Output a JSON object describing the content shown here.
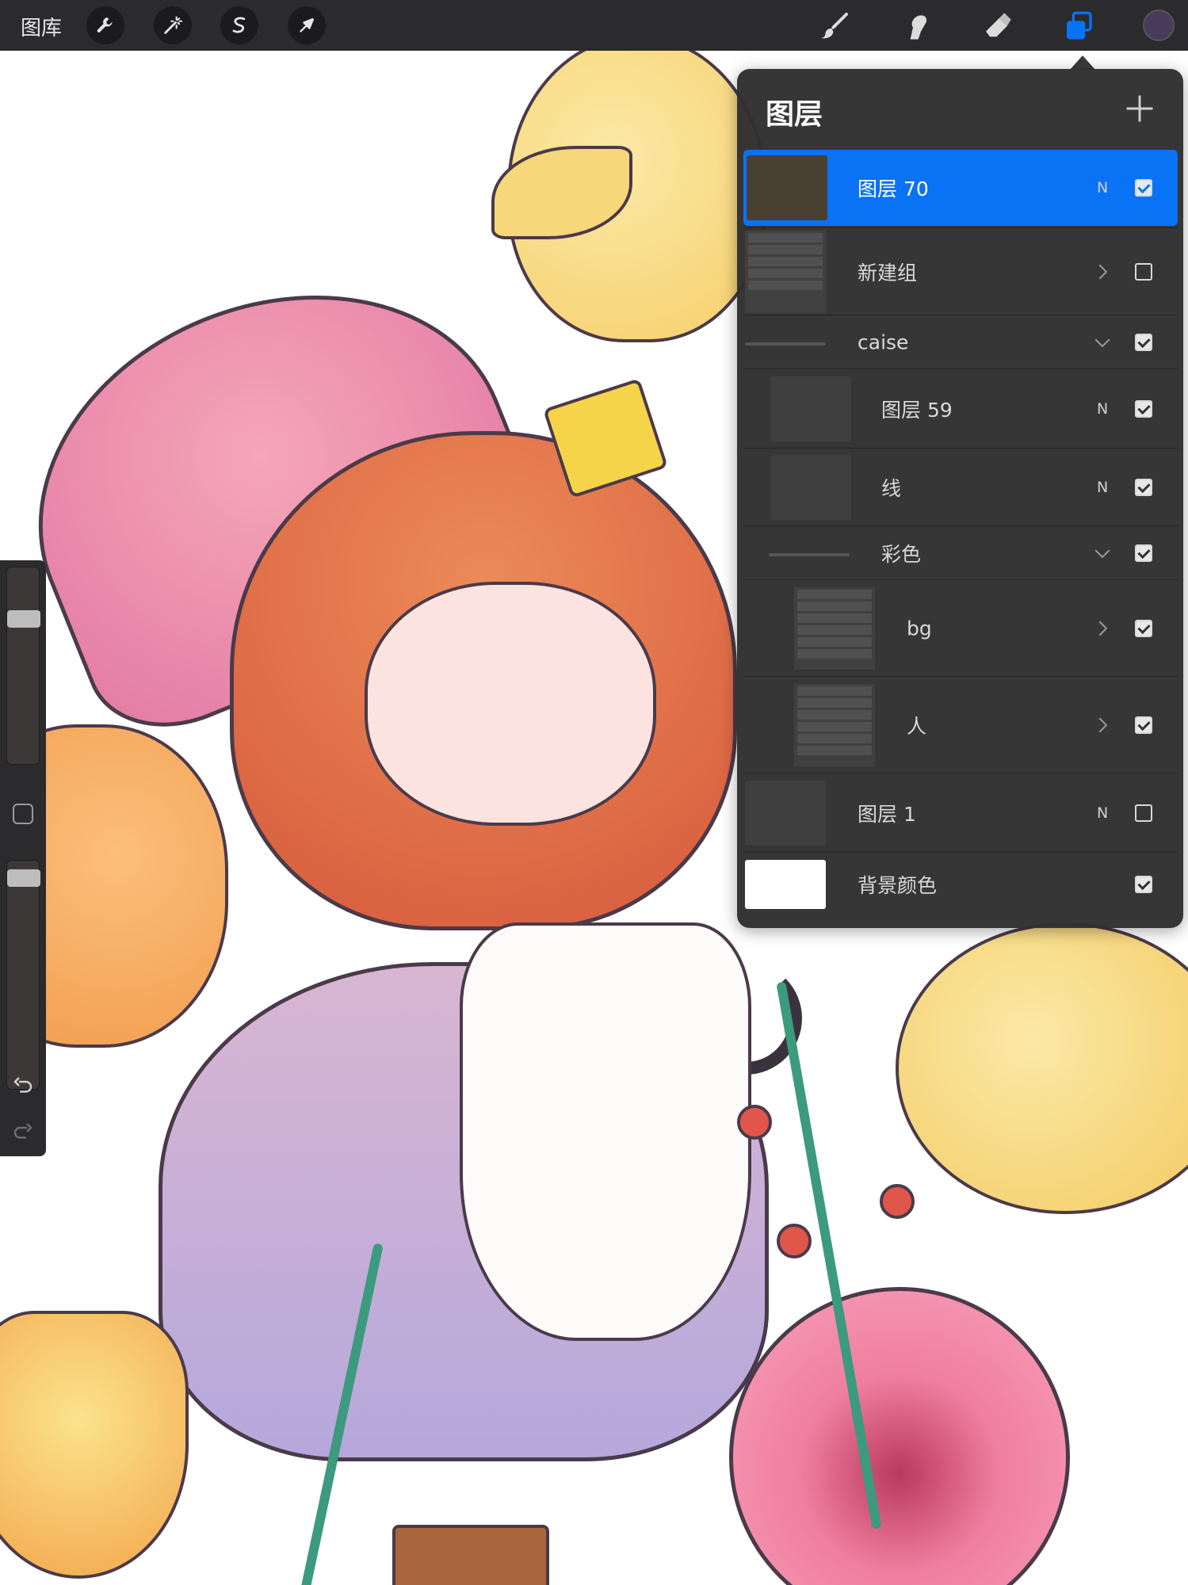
{
  "toolbar": {
    "gallery_label": "图库",
    "left_tools": [
      {
        "name": "actions",
        "icon": "wrench-icon"
      },
      {
        "name": "adjustments",
        "icon": "magic-wand-icon"
      },
      {
        "name": "selection",
        "icon": "selection-s-icon"
      },
      {
        "name": "transform",
        "icon": "arrow-cursor-icon"
      }
    ],
    "right_tools": [
      {
        "name": "paint",
        "icon": "brush-icon"
      },
      {
        "name": "smudge",
        "icon": "smudge-finger-icon"
      },
      {
        "name": "erase",
        "icon": "eraser-icon"
      },
      {
        "name": "layers",
        "icon": "layers-icon",
        "active": true
      }
    ],
    "current_color": "#4a3a5c",
    "accent_color": "#0a72f5"
  },
  "sidebar": {
    "brush_size_level": 0.76,
    "opacity_level": 0.96
  },
  "layers_panel": {
    "title": "图层",
    "add_icon": "plus-icon",
    "layers": [
      {
        "name": "图层 70",
        "blend": "N",
        "visible": true,
        "selected": true,
        "kind": "layer",
        "indent": 0
      },
      {
        "name": "新建组",
        "blend": "",
        "visible": false,
        "kind": "group-collapsed",
        "indent": 0
      },
      {
        "name": "caise",
        "blend": "",
        "visible": true,
        "kind": "group-expanded",
        "indent": 0
      },
      {
        "name": "图层 59",
        "blend": "N",
        "visible": true,
        "kind": "layer",
        "indent": 1
      },
      {
        "name": "线",
        "blend": "N",
        "visible": true,
        "kind": "layer",
        "indent": 1
      },
      {
        "name": "彩色",
        "blend": "",
        "visible": true,
        "kind": "group-expanded",
        "indent": 1
      },
      {
        "name": "bg",
        "blend": "",
        "visible": true,
        "kind": "group-collapsed",
        "indent": 2
      },
      {
        "name": "人",
        "blend": "",
        "visible": true,
        "kind": "group-collapsed",
        "indent": 2
      },
      {
        "name": "图层 1",
        "blend": "N",
        "visible": false,
        "kind": "layer",
        "indent": 0
      },
      {
        "name": "背景颜色",
        "blend": "",
        "visible": true,
        "kind": "background",
        "indent": 0
      }
    ]
  }
}
